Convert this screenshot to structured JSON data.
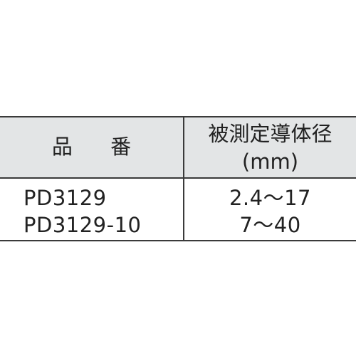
{
  "table": {
    "header": {
      "part_number": "品 番",
      "measured_conductor_diameter": "被測定導体径",
      "unit": "(mm)"
    },
    "rows": [
      {
        "part_number": "PD3129",
        "range": "2.4～17"
      },
      {
        "part_number": "PD3129-10",
        "range": "7～40"
      }
    ]
  },
  "colors": {
    "header_background": "#e3e5e6",
    "rule_lines": "#3a3a3a",
    "text": "#222222"
  }
}
